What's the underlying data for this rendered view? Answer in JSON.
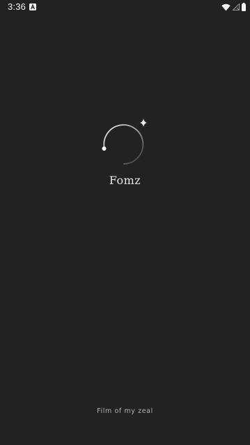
{
  "status_bar": {
    "time": "3:36",
    "notification_icon": "a-badge-icon",
    "wifi_icon": "wifi-icon",
    "signal_icon": "signal-icon",
    "battery_icon": "battery-icon"
  },
  "splash": {
    "logo_icon": "orbit-sparkle-icon",
    "app_name": "Fomz",
    "tagline": "Film of my zeal"
  },
  "colors": {
    "background": "#222222",
    "foreground": "#e6e6e6",
    "tagline": "#b3b3b3"
  }
}
